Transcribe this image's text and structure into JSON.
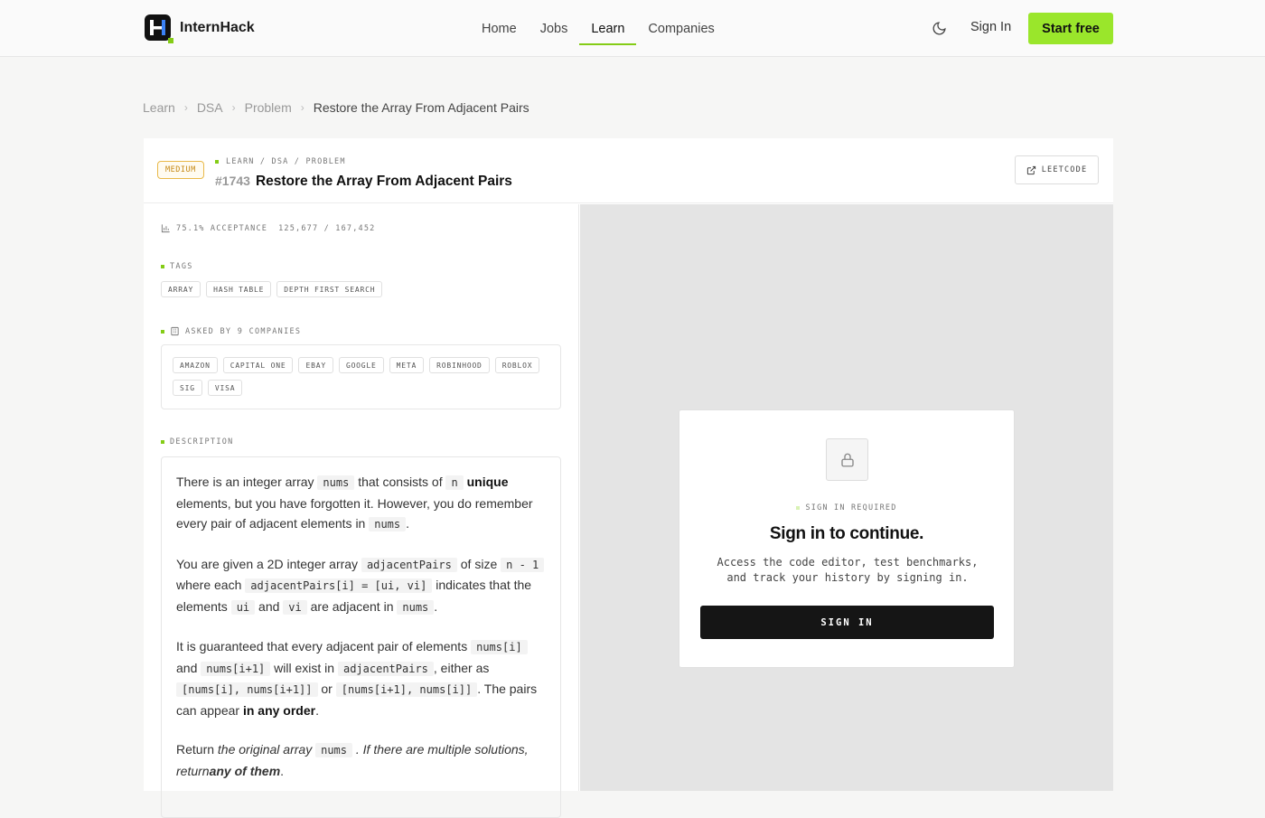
{
  "header": {
    "logo_text": "InternHack",
    "nav": [
      "Home",
      "Jobs",
      "Learn",
      "Companies"
    ],
    "active_nav": "Learn",
    "signin_label": "Sign In",
    "start_label": "Start free",
    "accent_color": "#9ae62b"
  },
  "breadcrumb": {
    "items": [
      "Learn",
      "DSA",
      "Problem"
    ],
    "current": "Restore the Array From Adjacent Pairs"
  },
  "problem": {
    "difficulty": "MEDIUM",
    "path": "LEARN / DSA / PROBLEM",
    "number": "#1743",
    "title": "Restore the Array From Adjacent Pairs",
    "external_label": "LEETCODE",
    "acceptance": "75.1% ACCEPTANCE",
    "submissions": "125,677 / 167,452",
    "tags_label": "TAGS",
    "tags": [
      "ARRAY",
      "HASH TABLE",
      "DEPTH FIRST SEARCH"
    ],
    "companies_label": "ASKED BY 9 COMPANIES",
    "companies": [
      "AMAZON",
      "CAPITAL ONE",
      "EBAY",
      "GOOGLE",
      "META",
      "ROBINHOOD",
      "ROBLOX",
      "SIG",
      "VISA"
    ],
    "description_label": "DESCRIPTION",
    "description": {
      "p1": {
        "t1": "There is an integer array ",
        "c1": "nums",
        "t2": " that consists of ",
        "c2": "n",
        "b1": "unique",
        "t3": " elements, but you have forgotten it. However, you do remember every pair of adjacent elements in ",
        "c3": "nums",
        "t4": "."
      },
      "p2": {
        "t1": "You are given a 2D integer array ",
        "c1": "adjacentPairs",
        "t2": " of size ",
        "c2": "n - 1",
        "t3": " where each ",
        "c3": "adjacentPairs[i] = [ui, vi]",
        "t4": " indicates that the elements ",
        "c4": "ui",
        "t5": " and ",
        "c5": "vi",
        "t6": " are adjacent in ",
        "c6": "nums",
        "t7": "."
      },
      "p3": {
        "t1": "It is guaranteed that every adjacent pair of elements ",
        "c1": "nums[i]",
        "t2": " and ",
        "c2": "nums[i+1]",
        "t3": " will exist in ",
        "c3": "adjacentPairs",
        "t4": ", either as ",
        "c4": "[nums[i], nums[i+1]]",
        "t5": " or ",
        "c5": "[nums[i+1], nums[i]]",
        "t6": ". The pairs can appear ",
        "b1": "in any order",
        "t7": "."
      },
      "p4": {
        "t1": "Return ",
        "i1": "the original array",
        "c1": "nums",
        "i2": ". If there are multiple solutions, return",
        "bi1": "any of them",
        "t2": "."
      }
    }
  },
  "signin_panel": {
    "required_label": "SIGN IN REQUIRED",
    "title": "Sign in to continue.",
    "subtitle": "Access the code editor, test benchmarks, and track your history by signing in.",
    "button": "SIGN IN"
  }
}
